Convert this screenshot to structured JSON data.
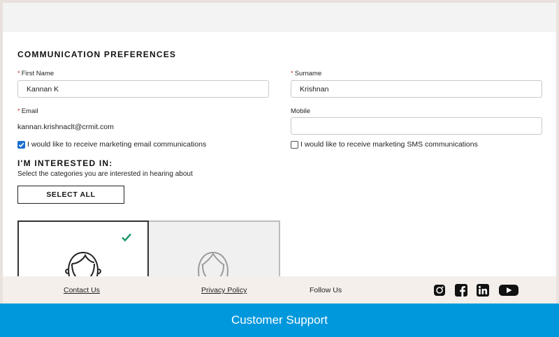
{
  "form": {
    "section_title": "COMMUNICATION PREFERENCES",
    "first_name": {
      "label": "First Name",
      "required": "*",
      "value": "Kannan K"
    },
    "surname": {
      "label": "Surname",
      "required": "*",
      "value": "Krishnan"
    },
    "email": {
      "label": "Email",
      "required": "*",
      "value": "kannan.krishnaclt@crmit.com"
    },
    "mobile": {
      "label": "Mobile",
      "value": ""
    },
    "email_optin": {
      "label": "I would like to receive marketing email communications",
      "checked": true
    },
    "sms_optin": {
      "label": "I would like to receive marketing SMS communications",
      "checked": false
    }
  },
  "interests": {
    "title": "I'M INTERESTED IN:",
    "subtitle": "Select the categories you are interested in hearing about",
    "select_all_label": "SELECT ALL",
    "cards": [
      {
        "icon": "woman-face-icon",
        "selected": true
      },
      {
        "icon": "woman-face-icon",
        "selected": false
      }
    ]
  },
  "footer": {
    "contact_label": "Contact Us",
    "privacy_label": "Privacy Policy",
    "follow_label": "Follow Us",
    "social_icons": [
      "instagram-icon",
      "facebook-icon",
      "linkedin-icon",
      "youtube-icon"
    ]
  },
  "support_bar": {
    "label": "Customer Support"
  },
  "colors": {
    "support_bar": "#0098dc",
    "checkmark": "#1f9b6c",
    "checkbox": "#1a6fd0",
    "required": "#c0392b"
  }
}
